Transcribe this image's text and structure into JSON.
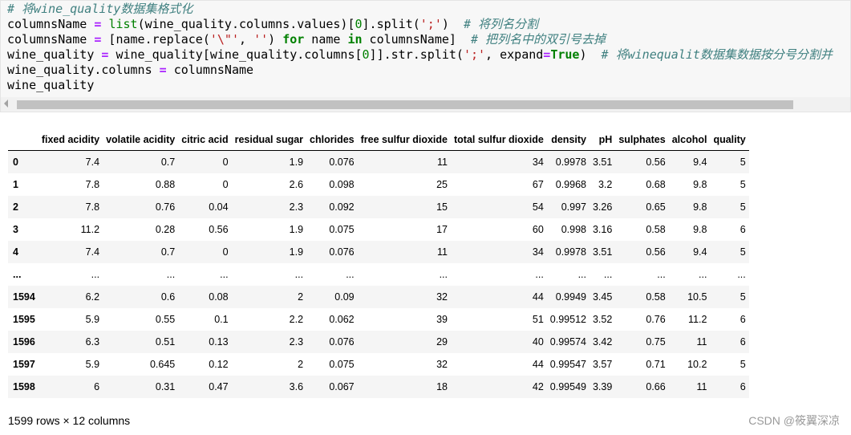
{
  "code_lines": [
    {
      "comment": "# 将wine_quality数据集格式化"
    },
    {
      "p1": "columnsName ",
      "op": "=",
      "p2": " ",
      "bi": "list",
      "p3": "(wine_quality.columns.values)[",
      "num": "0",
      "p4": "].split(",
      "str": "';'",
      "p5": ")  ",
      "comment": "# 将列名分割"
    },
    {
      "p1": "columnsName ",
      "op": "=",
      "p2": " [name.replace(",
      "str1": "'\\\"'",
      "p3": ", ",
      "str2": "''",
      "p4": ") ",
      "kw1": "for",
      "p5": " name ",
      "kw2": "in",
      "p6": " columnsName]  ",
      "comment": "# 把列名中的双引号去掉"
    },
    {
      "p1": "wine_quality ",
      "op": "=",
      "p2": " wine_quality[wine_quality.columns[",
      "num": "0",
      "p3": "]].str.split(",
      "str": "';'",
      "p4": ", expand",
      "op2": "=",
      "kw": "True",
      "p5": ")  ",
      "comment": "# 将winequalit数据集数据按分号分割并"
    },
    {
      "p1": "wine_quality.columns ",
      "op": "=",
      "p2": " columnsName"
    },
    {
      "p1": "wine_quality"
    }
  ],
  "table": {
    "columns": [
      "fixed acidity",
      "volatile acidity",
      "citric acid",
      "residual sugar",
      "chlorides",
      "free sulfur dioxide",
      "total sulfur dioxide",
      "density",
      "pH",
      "sulphates",
      "alcohol",
      "quality"
    ],
    "rows": [
      {
        "index": "0",
        "values": [
          "7.4",
          "0.7",
          "0",
          "1.9",
          "0.076",
          "11",
          "34",
          "0.9978",
          "3.51",
          "0.56",
          "9.4",
          "5"
        ]
      },
      {
        "index": "1",
        "values": [
          "7.8",
          "0.88",
          "0",
          "2.6",
          "0.098",
          "25",
          "67",
          "0.9968",
          "3.2",
          "0.68",
          "9.8",
          "5"
        ]
      },
      {
        "index": "2",
        "values": [
          "7.8",
          "0.76",
          "0.04",
          "2.3",
          "0.092",
          "15",
          "54",
          "0.997",
          "3.26",
          "0.65",
          "9.8",
          "5"
        ]
      },
      {
        "index": "3",
        "values": [
          "11.2",
          "0.28",
          "0.56",
          "1.9",
          "0.075",
          "17",
          "60",
          "0.998",
          "3.16",
          "0.58",
          "9.8",
          "6"
        ]
      },
      {
        "index": "4",
        "values": [
          "7.4",
          "0.7",
          "0",
          "1.9",
          "0.076",
          "11",
          "34",
          "0.9978",
          "3.51",
          "0.56",
          "9.4",
          "5"
        ]
      },
      {
        "index": "...",
        "values": [
          "...",
          "...",
          "...",
          "...",
          "...",
          "...",
          "...",
          "...",
          "...",
          "...",
          "...",
          "..."
        ]
      },
      {
        "index": "1594",
        "values": [
          "6.2",
          "0.6",
          "0.08",
          "2",
          "0.09",
          "32",
          "44",
          "0.9949",
          "3.45",
          "0.58",
          "10.5",
          "5"
        ]
      },
      {
        "index": "1595",
        "values": [
          "5.9",
          "0.55",
          "0.1",
          "2.2",
          "0.062",
          "39",
          "51",
          "0.99512",
          "3.52",
          "0.76",
          "11.2",
          "6"
        ]
      },
      {
        "index": "1596",
        "values": [
          "6.3",
          "0.51",
          "0.13",
          "2.3",
          "0.076",
          "29",
          "40",
          "0.99574",
          "3.42",
          "0.75",
          "11",
          "6"
        ]
      },
      {
        "index": "1597",
        "values": [
          "5.9",
          "0.645",
          "0.12",
          "2",
          "0.075",
          "32",
          "44",
          "0.99547",
          "3.57",
          "0.71",
          "10.2",
          "5"
        ]
      },
      {
        "index": "1598",
        "values": [
          "6",
          "0.31",
          "0.47",
          "3.6",
          "0.067",
          "18",
          "42",
          "0.99549",
          "3.39",
          "0.66",
          "11",
          "6"
        ]
      }
    ]
  },
  "shape_note": "1599 rows × 12 columns",
  "watermark": "CSDN @筱翼深凉",
  "colors": {
    "comment": "#408080",
    "operator": "#aa22ff",
    "keyword": "#008000",
    "string": "#ba2121",
    "stripe": "#f5f5f5"
  },
  "icons": {
    "scroll_left": "triangle-left"
  }
}
